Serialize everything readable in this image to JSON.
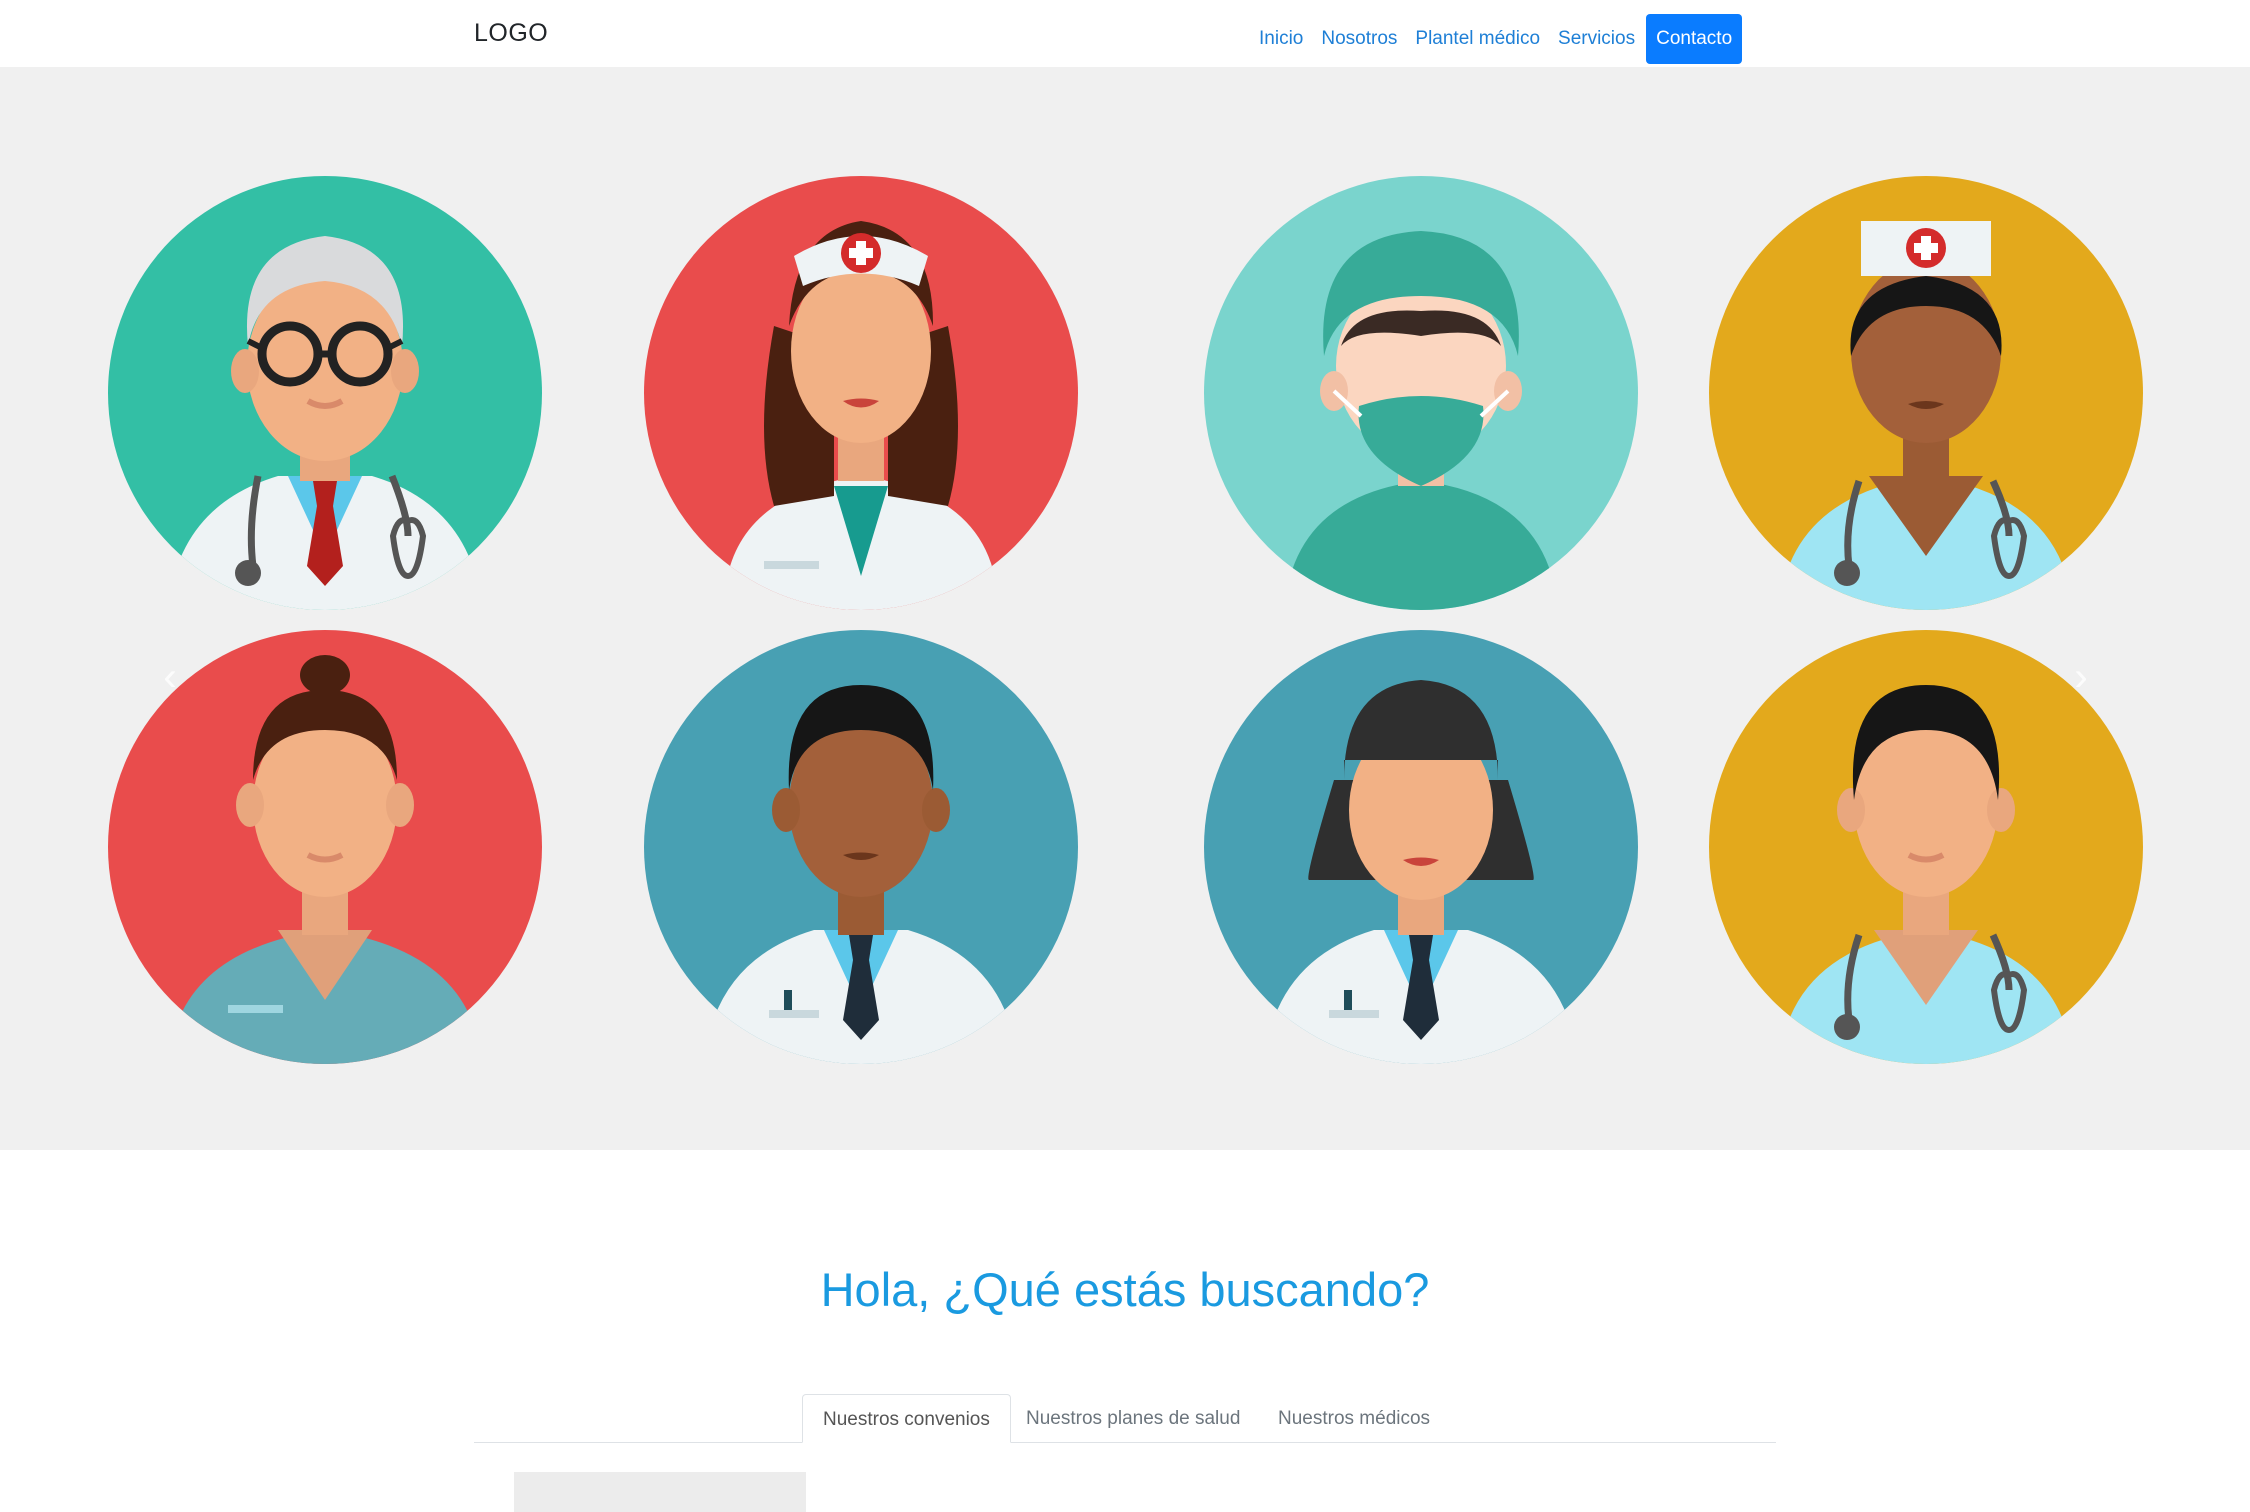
{
  "navbar": {
    "logo": "LOGO",
    "links": [
      "Inicio",
      "Nosotros",
      "Plantel médico",
      "Servicios"
    ],
    "cta": "Contacto"
  },
  "carousel": {
    "prev_icon": "chevron-left-icon",
    "next_icon": "chevron-right-icon",
    "avatars": [
      {
        "name": "senior-male-doctor-avatar",
        "bg": "#33bfa5"
      },
      {
        "name": "nurse-female-avatar",
        "bg": "#e94c4c"
      },
      {
        "name": "surgeon-masked-avatar",
        "bg": "#7ad4cd"
      },
      {
        "name": "nurse-dark-skin-avatar",
        "bg": "#e3a91c"
      },
      {
        "name": "female-staff-avatar",
        "bg": "#e94c4c"
      },
      {
        "name": "male-doctor-dark-skin-avatar",
        "bg": "#48a0b3"
      },
      {
        "name": "female-doctor-avatar",
        "bg": "#48a0b3"
      },
      {
        "name": "male-medic-avatar",
        "bg": "#e3a91c"
      }
    ]
  },
  "search": {
    "headline": "Hola, ¿Qué estás buscando?",
    "tabs": [
      "Nuestros convenios",
      "Nuestros planes de salud",
      "Nuestros médicos"
    ],
    "active_tab": 0
  },
  "colors": {
    "accent": "#0a7cff",
    "link": "#1e7fd6",
    "headline": "#1a9ae0",
    "hero_bg": "#f0f0f0"
  }
}
